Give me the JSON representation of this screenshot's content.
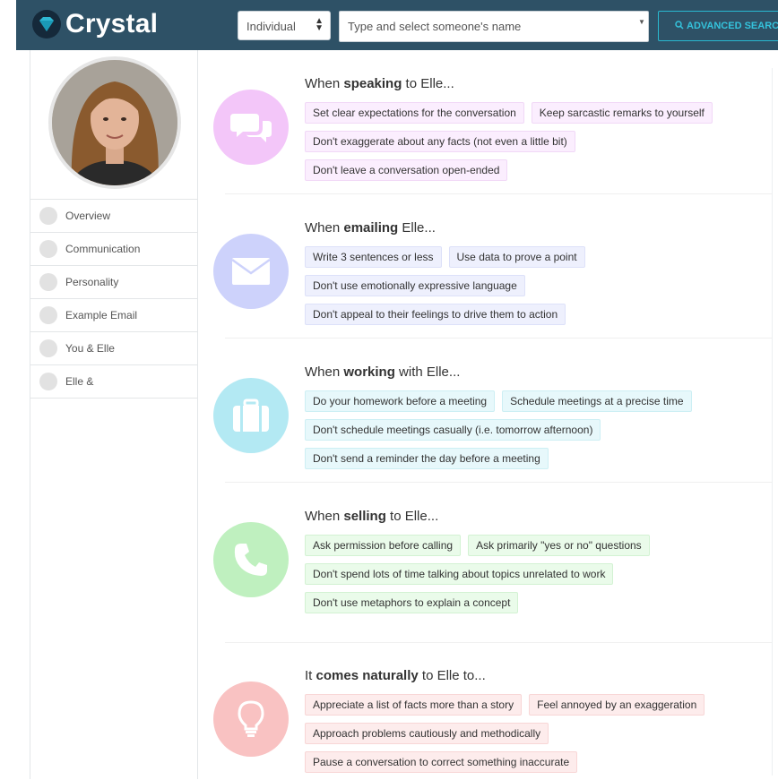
{
  "app": {
    "name": "Crystal"
  },
  "colors": {
    "header_bg": "#2e5166",
    "accent": "#34c3dc",
    "speaking": "#f3c6f9",
    "emailing": "#cdd2fb",
    "working": "#b3e9f3",
    "selling": "#bff0bf",
    "naturally": "#f9c2c2"
  },
  "header": {
    "type_select": "Individual",
    "name_placeholder": "Type and select someone's name",
    "advanced_search": "ADVANCED SEARCH"
  },
  "sidebar": {
    "items": [
      {
        "label": "Overview",
        "icon": "overview-icon"
      },
      {
        "label": "Communication",
        "icon": "communication-icon"
      },
      {
        "label": "Personality",
        "icon": "personality-icon"
      },
      {
        "label": "Example Email",
        "icon": "email-icon"
      },
      {
        "label": "You & Elle",
        "icon": "you-and-elle-icon"
      },
      {
        "label": "Elle &",
        "icon": "elle-and-icon"
      }
    ]
  },
  "sections": [
    {
      "title_pre": "When ",
      "title_bold": "speaking",
      "title_post": " to Elle...",
      "icon": "speech-bubbles-icon",
      "rows": [
        [
          "Set clear expectations for the conversation",
          "Keep sarcastic remarks to yourself"
        ],
        [
          "Don't exaggerate about any facts (not even a little bit)"
        ],
        [
          "Don't leave a conversation open-ended"
        ]
      ]
    },
    {
      "title_pre": "When ",
      "title_bold": "emailing",
      "title_post": " Elle...",
      "icon": "envelope-icon",
      "rows": [
        [
          "Write 3 sentences or less",
          "Use data to prove a point"
        ],
        [
          "Don't use emotionally expressive language"
        ],
        [
          "Don't appeal to their feelings to drive them to action"
        ]
      ]
    },
    {
      "title_pre": "When ",
      "title_bold": "working",
      "title_post": " with Elle...",
      "icon": "briefcase-icon",
      "rows": [
        [
          "Do your homework before a meeting",
          "Schedule meetings at a precise time"
        ],
        [
          "Don't schedule meetings casually (i.e. tomorrow afternoon)"
        ],
        [
          "Don't send a reminder the day before a meeting"
        ]
      ]
    },
    {
      "title_pre": "When ",
      "title_bold": "selling",
      "title_post": " to Elle...",
      "icon": "phone-icon",
      "rows": [
        [
          "Ask permission before calling",
          "Ask primarily \"yes or no\" questions"
        ],
        [
          "Don't spend lots of time talking about topics unrelated to work"
        ],
        [
          "Don't use metaphors to explain a concept"
        ]
      ]
    },
    {
      "title_pre": "It ",
      "title_bold": "comes naturally",
      "title_post": " to Elle to...",
      "icon": "lightbulb-icon",
      "rows": [
        [
          "Appreciate a list of facts more than a story",
          "Feel annoyed by an exaggeration"
        ],
        [
          "Approach problems cautiously and methodically"
        ],
        [
          "Pause a conversation to correct something inaccurate"
        ]
      ]
    }
  ]
}
